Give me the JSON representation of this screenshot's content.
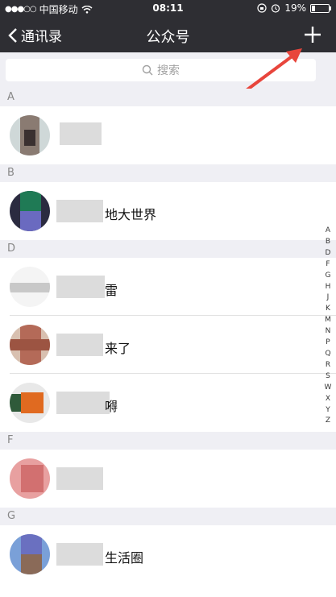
{
  "status": {
    "carrier": "中国移动",
    "time": "08:11",
    "battery": "19%"
  },
  "nav": {
    "back_label": "通讯录",
    "title": "公众号",
    "add_icon": "plus-icon"
  },
  "search": {
    "placeholder": "搜索"
  },
  "sections": [
    {
      "letter": "A",
      "items": [
        {
          "name": ""
        }
      ]
    },
    {
      "letter": "B",
      "items": [
        {
          "name": "地大世界"
        }
      ]
    },
    {
      "letter": "D",
      "items": [
        {
          "name": "雷"
        },
        {
          "name": "来了"
        },
        {
          "name": "嘚"
        }
      ]
    },
    {
      "letter": "F",
      "items": [
        {
          "name": ""
        }
      ]
    },
    {
      "letter": "G",
      "items": [
        {
          "name": "生活圈"
        }
      ]
    }
  ],
  "index_letters": [
    "A",
    "B",
    "D",
    "F",
    "G",
    "H",
    "J",
    "K",
    "M",
    "N",
    "P",
    "Q",
    "R",
    "S",
    "W",
    "X",
    "Y",
    "Z"
  ],
  "colors": {
    "nav_bg": "#2e2e33",
    "annotation_arrow": "#e8453c"
  }
}
